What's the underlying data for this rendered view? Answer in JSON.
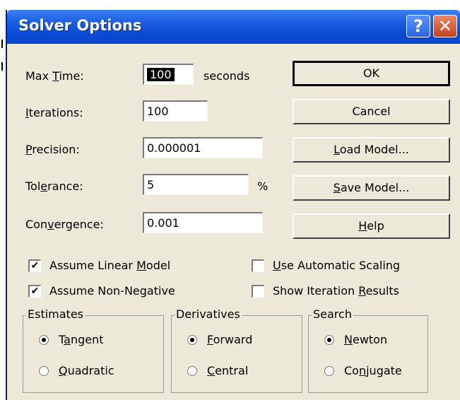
{
  "window": {
    "title": "Solver Options",
    "help_glyph": "?",
    "close_glyph": "✕"
  },
  "fields": {
    "max_time": {
      "label": "Max Time:",
      "value": "100",
      "unit": "seconds"
    },
    "iterations": {
      "label": "Iterations:",
      "value": "100"
    },
    "precision": {
      "label": "Precision:",
      "value": "0.000001"
    },
    "tolerance": {
      "label": "Tolerance:",
      "value": "5",
      "unit": "%"
    },
    "convergence": {
      "label": "Convergence:",
      "value": "0.001"
    }
  },
  "buttons": {
    "ok": "OK",
    "cancel": "Cancel",
    "load_model": "Load Model...",
    "save_model": "Save Model...",
    "help": "Help"
  },
  "checkboxes": {
    "assume_linear": {
      "label": "Assume Linear Model",
      "checked": true
    },
    "assume_nonneg": {
      "label": "Assume Non-Negative",
      "checked": true
    },
    "auto_scaling": {
      "label": "Use Automatic Scaling",
      "checked": false
    },
    "show_iter": {
      "label": "Show Iteration Results",
      "checked": false
    }
  },
  "groups": {
    "estimates": {
      "title": "Estimates",
      "options": [
        "Tangent",
        "Quadratic"
      ],
      "selected": "Tangent"
    },
    "derivatives": {
      "title": "Derivatives",
      "options": [
        "Forward",
        "Central"
      ],
      "selected": "Forward"
    },
    "search": {
      "title": "Search",
      "options": [
        "Newton",
        "Conjugate"
      ],
      "selected": "Newton"
    }
  },
  "check_glyph": "✔"
}
